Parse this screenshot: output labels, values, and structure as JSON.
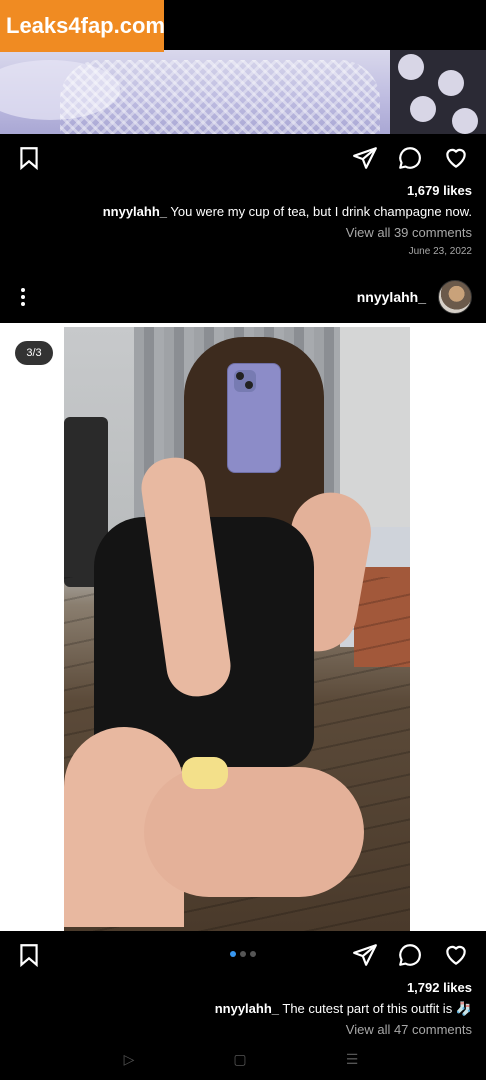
{
  "watermark": {
    "text": "Leaks4fap.com"
  },
  "post1": {
    "likes": "1,679 likes",
    "caption_user": "nnyylahh_",
    "caption_text": "You were my cup of tea, but I drink champagne now.",
    "comments": "View all 39 comments",
    "date": "June 23, 2022"
  },
  "post2": {
    "username": "nnyylahh_",
    "counter": "3/3",
    "likes": "1,792 likes",
    "caption_user": "nnyylahh_",
    "caption_text": "The cutest part of this outfit is 🧦",
    "comments": "View all 47 comments",
    "carousel": {
      "total": 3,
      "active": 0
    }
  },
  "icons": {
    "bookmark": "bookmark-icon",
    "share": "share-icon",
    "comment": "comment-icon",
    "like": "heart-icon",
    "more": "more-options-icon"
  },
  "navbar": {
    "back": "▷",
    "home": "▢",
    "recents": "☰"
  },
  "colors": {
    "background": "#000000",
    "secondary_text": "#a8a8a8",
    "watermark_bg": "#f08b22",
    "carousel_active": "#3897f0"
  }
}
